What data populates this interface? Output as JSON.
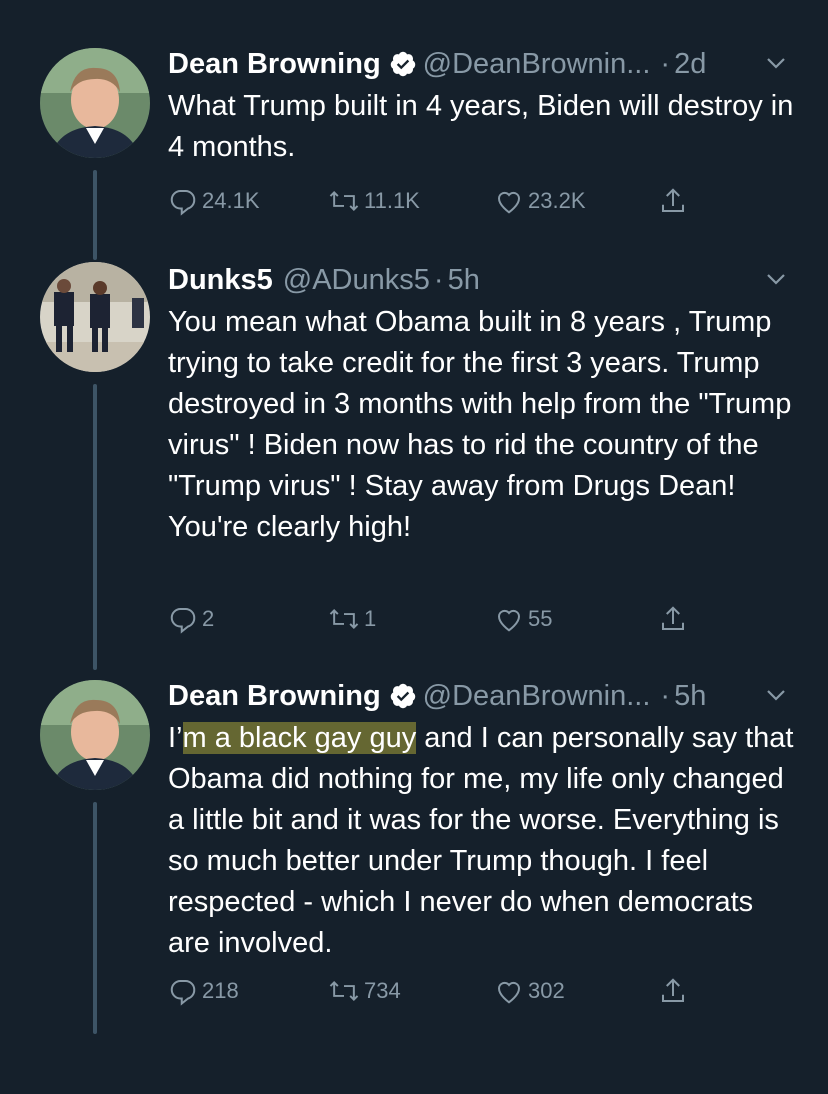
{
  "tweets": [
    {
      "name": "Dean Browning",
      "verified": true,
      "handle": "@DeanBrownin...",
      "sep": "·",
      "time": "2d",
      "text": "What Trump built in 4 years, Biden will destroy in 4 months.",
      "replies": "24.1K",
      "retweets": "11.1K",
      "likes": "23.2K"
    },
    {
      "name": "Dunks5",
      "verified": false,
      "handle": "@ADunks5",
      "sep": "·",
      "time": "5h",
      "text": "You mean what Obama built in 8 years , Trump trying to take credit for the first 3 years. Trump destroyed in 3 months with help from the \"Trump virus\" ! Biden now has to rid the country of the \"Trump virus\" ! Stay away from Drugs Dean! You're clearly high!",
      "replies": "2",
      "retweets": "1",
      "likes": "55"
    },
    {
      "name": "Dean Browning",
      "verified": true,
      "handle": "@DeanBrownin...",
      "sep": "·",
      "time": "5h",
      "text_before": "I’",
      "text_highlight": "m a black gay guy",
      "text_after": " and I can personally say that Obama did nothing for me, my life only changed a little bit and it was for the worse. Everything is so much better under Trump though. I feel respected - which I never do when democrats are involved.",
      "replies": "218",
      "retweets": "734",
      "likes": "302"
    }
  ],
  "colors": {
    "background": "#15202b",
    "secondary_text": "#8899a6",
    "verified_badge": "#ffffff",
    "highlight": "rgba(200,190,60,0.45)"
  },
  "icons": [
    "reply-icon",
    "retweet-icon",
    "like-icon",
    "share-icon",
    "verified-icon",
    "chevron-down-icon"
  ]
}
